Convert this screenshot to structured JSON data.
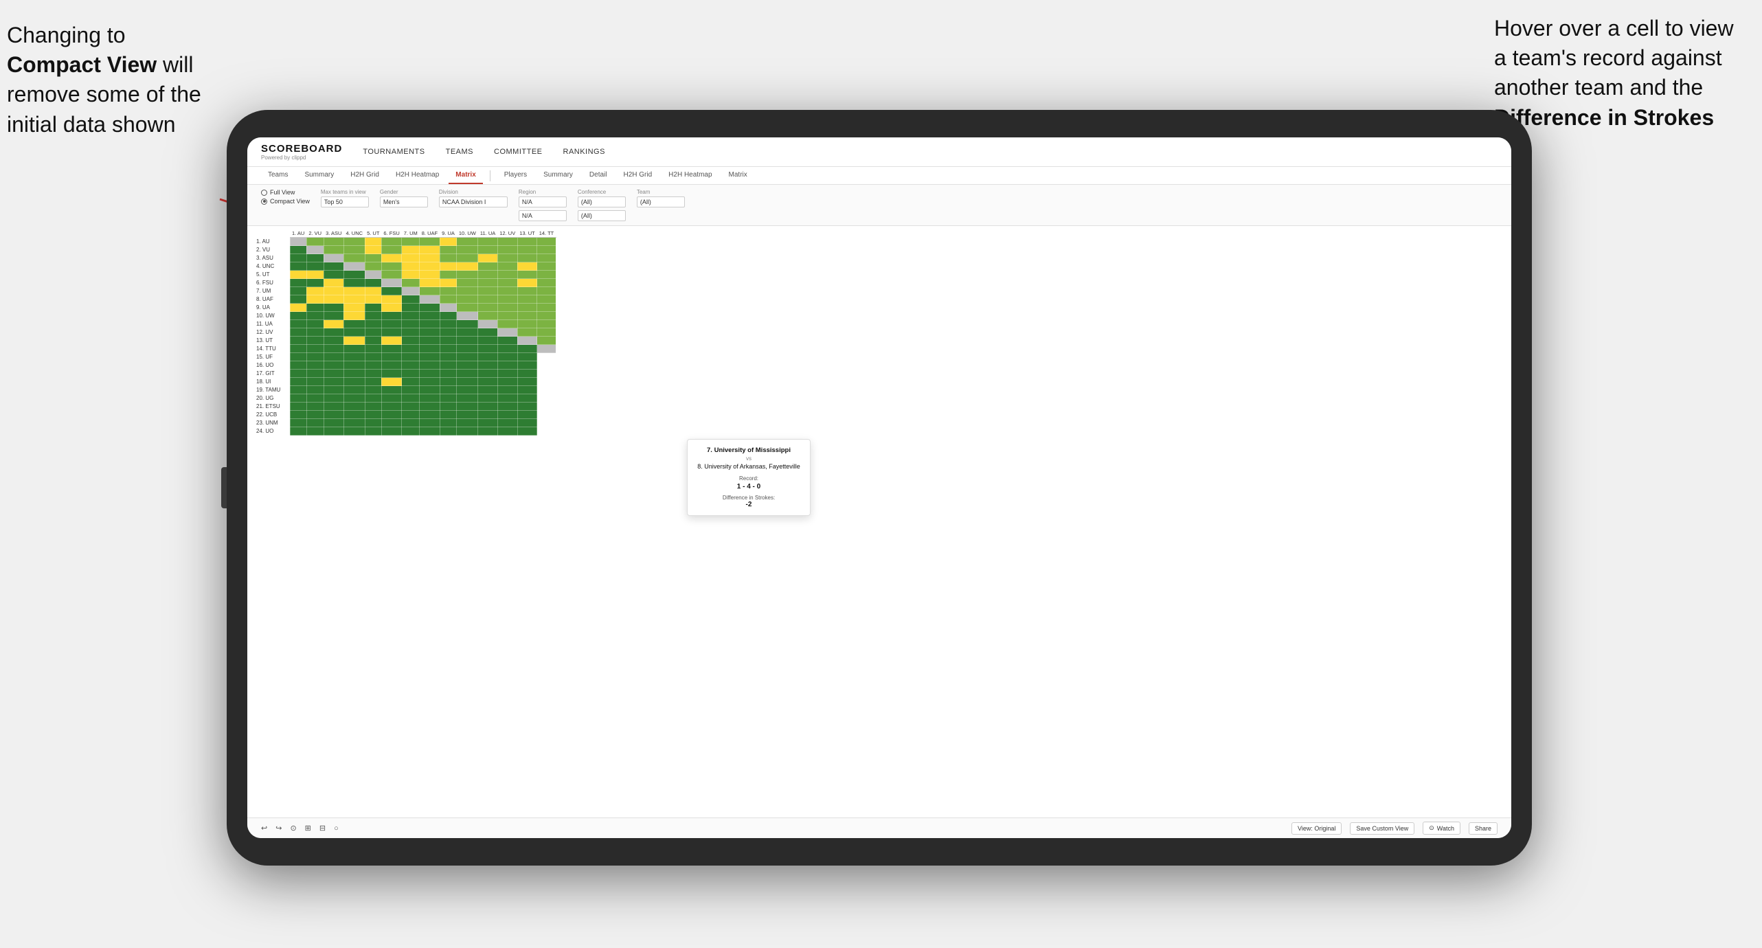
{
  "annotations": {
    "left_text_part1": "Changing to",
    "left_text_bold": "Compact View",
    "left_text_part2": "will remove some of the initial data shown",
    "right_text_part1": "Hover over a cell to view a team's record against another team and the",
    "right_text_bold": "Difference in Strokes"
  },
  "navbar": {
    "logo": "SCOREBOARD",
    "logo_sub": "Powered by clippd",
    "links": [
      "TOURNAMENTS",
      "TEAMS",
      "COMMITTEE",
      "RANKINGS"
    ]
  },
  "subtabs_left": [
    "Teams",
    "Summary",
    "H2H Grid",
    "H2H Heatmap",
    "Matrix"
  ],
  "subtabs_right": [
    "Players",
    "Summary",
    "Detail",
    "H2H Grid",
    "H2H Heatmap",
    "Matrix"
  ],
  "active_tab": "Matrix",
  "controls": {
    "view_options": [
      "Full View",
      "Compact View"
    ],
    "selected_view": "Compact View",
    "filters": [
      {
        "label": "Max teams in view",
        "value": "Top 50"
      },
      {
        "label": "Gender",
        "value": "Men's"
      },
      {
        "label": "Division",
        "value": "NCAA Division I"
      },
      {
        "label": "Region",
        "value": "N/A",
        "second_value": "N/A"
      },
      {
        "label": "Conference",
        "value": "(All)",
        "second_value": "(All)"
      },
      {
        "label": "Team",
        "value": "(All)"
      }
    ]
  },
  "column_headers": [
    "1. AU",
    "2. VU",
    "3. ASU",
    "4. UNC",
    "5. UT",
    "6. FSU",
    "7. UM",
    "8. UAF",
    "9. UA",
    "10. UW",
    "11. UA",
    "12. UV",
    "13. UT",
    "14. TT"
  ],
  "rows": [
    {
      "label": "1. AU",
      "cells": [
        "",
        "g",
        "g",
        "g",
        "y",
        "g",
        "g",
        "g",
        "y",
        "g",
        "g",
        "g",
        "g",
        "g"
      ]
    },
    {
      "label": "2. VU",
      "cells": [
        "d",
        "",
        "g",
        "g",
        "y",
        "g",
        "y",
        "y",
        "g",
        "g",
        "g",
        "g",
        "g",
        "g"
      ]
    },
    {
      "label": "3. ASU",
      "cells": [
        "d",
        "d",
        "",
        "g",
        "g",
        "y",
        "y",
        "y",
        "g",
        "g",
        "y",
        "g",
        "g",
        "g"
      ]
    },
    {
      "label": "4. UNC",
      "cells": [
        "d",
        "d",
        "d",
        "",
        "g",
        "g",
        "y",
        "y",
        "y",
        "y",
        "g",
        "g",
        "y",
        "g"
      ]
    },
    {
      "label": "5. UT",
      "cells": [
        "y",
        "y",
        "d",
        "d",
        "",
        "g",
        "y",
        "y",
        "g",
        "g",
        "g",
        "g",
        "g",
        "g"
      ]
    },
    {
      "label": "6. FSU",
      "cells": [
        "d",
        "d",
        "y",
        "d",
        "d",
        "",
        "g",
        "y",
        "y",
        "g",
        "g",
        "g",
        "y",
        "g"
      ]
    },
    {
      "label": "7. UM",
      "cells": [
        "d",
        "y",
        "y",
        "y",
        "y",
        "d",
        "",
        "g",
        "g",
        "g",
        "g",
        "g",
        "g",
        "g"
      ]
    },
    {
      "label": "8. UAF",
      "cells": [
        "d",
        "y",
        "y",
        "y",
        "y",
        "y",
        "d",
        "",
        "g",
        "g",
        "g",
        "g",
        "g",
        "g"
      ]
    },
    {
      "label": "9. UA",
      "cells": [
        "y",
        "d",
        "d",
        "y",
        "d",
        "y",
        "d",
        "d",
        "",
        "g",
        "g",
        "g",
        "g",
        "g"
      ]
    },
    {
      "label": "10. UW",
      "cells": [
        "d",
        "d",
        "d",
        "y",
        "d",
        "d",
        "d",
        "d",
        "d",
        "",
        "g",
        "g",
        "g",
        "g"
      ]
    },
    {
      "label": "11. UA",
      "cells": [
        "d",
        "d",
        "y",
        "d",
        "d",
        "d",
        "d",
        "d",
        "d",
        "d",
        "",
        "g",
        "g",
        "g"
      ]
    },
    {
      "label": "12. UV",
      "cells": [
        "d",
        "d",
        "d",
        "d",
        "d",
        "d",
        "d",
        "d",
        "d",
        "d",
        "d",
        "",
        "g",
        "g"
      ]
    },
    {
      "label": "13. UT",
      "cells": [
        "d",
        "d",
        "d",
        "y",
        "d",
        "y",
        "d",
        "d",
        "d",
        "d",
        "d",
        "d",
        "",
        "g"
      ]
    },
    {
      "label": "14. TTU",
      "cells": [
        "d",
        "d",
        "d",
        "d",
        "d",
        "d",
        "d",
        "d",
        "d",
        "d",
        "d",
        "d",
        "d",
        ""
      ]
    },
    {
      "label": "15. UF",
      "cells": [
        "d",
        "d",
        "d",
        "d",
        "d",
        "d",
        "d",
        "d",
        "d",
        "d",
        "d",
        "d",
        "d",
        ""
      ]
    },
    {
      "label": "16. UO",
      "cells": [
        "d",
        "d",
        "d",
        "d",
        "d",
        "d",
        "d",
        "d",
        "d",
        "d",
        "d",
        "d",
        "d",
        ""
      ]
    },
    {
      "label": "17. GIT",
      "cells": [
        "d",
        "d",
        "d",
        "d",
        "d",
        "d",
        "d",
        "d",
        "d",
        "d",
        "d",
        "d",
        "d",
        ""
      ]
    },
    {
      "label": "18. UI",
      "cells": [
        "d",
        "d",
        "d",
        "d",
        "d",
        "y",
        "d",
        "d",
        "d",
        "d",
        "d",
        "d",
        "d",
        ""
      ]
    },
    {
      "label": "19. TAMU",
      "cells": [
        "d",
        "d",
        "d",
        "d",
        "d",
        "d",
        "d",
        "d",
        "d",
        "d",
        "d",
        "d",
        "d",
        ""
      ]
    },
    {
      "label": "20. UG",
      "cells": [
        "d",
        "d",
        "d",
        "d",
        "d",
        "d",
        "d",
        "d",
        "d",
        "d",
        "d",
        "d",
        "d",
        ""
      ]
    },
    {
      "label": "21. ETSU",
      "cells": [
        "d",
        "d",
        "d",
        "d",
        "d",
        "d",
        "d",
        "d",
        "d",
        "d",
        "d",
        "d",
        "d",
        ""
      ]
    },
    {
      "label": "22. UCB",
      "cells": [
        "d",
        "d",
        "d",
        "d",
        "d",
        "d",
        "d",
        "d",
        "d",
        "d",
        "d",
        "d",
        "d",
        ""
      ]
    },
    {
      "label": "23. UNM",
      "cells": [
        "d",
        "d",
        "d",
        "d",
        "d",
        "d",
        "d",
        "d",
        "d",
        "d",
        "d",
        "d",
        "d",
        ""
      ]
    },
    {
      "label": "24. UO",
      "cells": [
        "d",
        "d",
        "d",
        "d",
        "d",
        "d",
        "d",
        "d",
        "d",
        "d",
        "d",
        "d",
        "d",
        ""
      ]
    }
  ],
  "tooltip": {
    "team1": "7. University of Mississippi",
    "vs": "vs",
    "team2": "8. University of Arkansas, Fayetteville",
    "record_label": "Record:",
    "record": "1 - 4 - 0",
    "diff_label": "Difference in Strokes:",
    "diff": "-2"
  },
  "toolbar": {
    "buttons": [
      "↩",
      "↪",
      "⊙",
      "⊞",
      "⊟",
      "○"
    ],
    "view_original": "View: Original",
    "save_custom": "Save Custom View",
    "watch": "Watch",
    "share": "Share"
  }
}
